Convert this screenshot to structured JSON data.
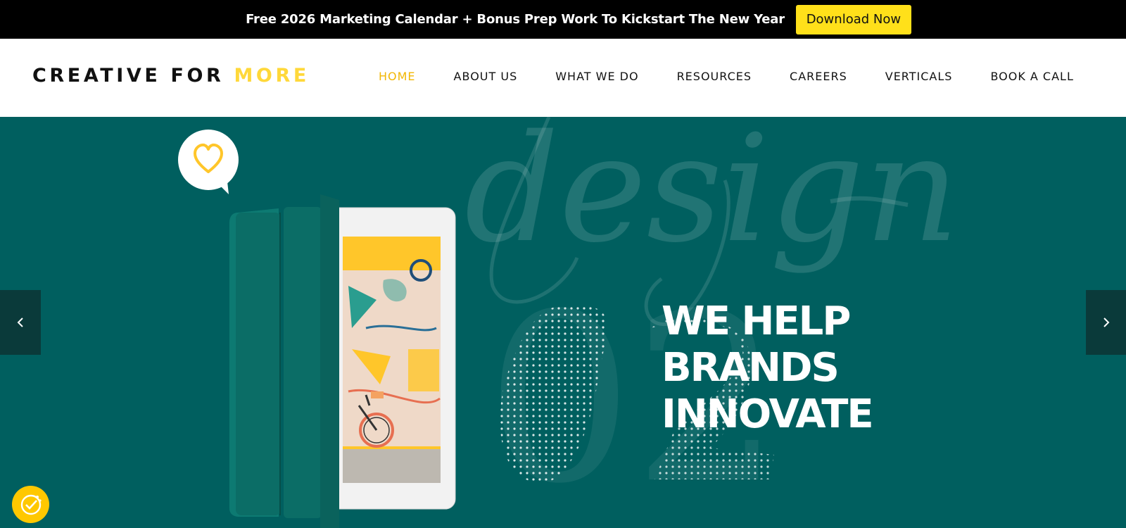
{
  "announcement": {
    "text": "Free 2026 Marketing Calendar + Bonus Prep Work To Kickstart The New Year",
    "button_label": "Download Now"
  },
  "header": {
    "logo_main": "CREATIVE FOR ",
    "logo_accent": "MORE",
    "nav": [
      {
        "label": "HOME",
        "active": true
      },
      {
        "label": "ABOUT US",
        "active": false
      },
      {
        "label": "WHAT WE DO",
        "active": false
      },
      {
        "label": "RESOURCES",
        "active": false
      },
      {
        "label": "CAREERS",
        "active": false
      },
      {
        "label": "VERTICALS",
        "active": false
      },
      {
        "label": "BOOK A CALL",
        "active": false
      }
    ]
  },
  "hero": {
    "headline": [
      "WE HELP",
      "BRANDS",
      "INNOVATE"
    ],
    "slide_number": "02",
    "script_word": "design",
    "prev_icon": "chevron-left-icon",
    "next_icon": "chevron-right-icon"
  },
  "colors": {
    "brand_yellow": "#ffd83a",
    "nav_active": "#f2b705",
    "hero_bg": "#005f5f",
    "topbar_bg": "#000000",
    "button_yellow": "#ffe01a"
  },
  "accessibility": {
    "icon": "accessibility-icon"
  }
}
